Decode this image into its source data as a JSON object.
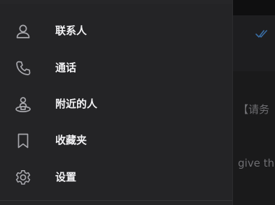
{
  "drawer": {
    "items": [
      {
        "label": "联系人",
        "icon": "person-icon"
      },
      {
        "label": "通话",
        "icon": "phone-icon"
      },
      {
        "label": "附近的人",
        "icon": "people-nearby-icon"
      },
      {
        "label": "收藏夹",
        "icon": "bookmark-icon"
      },
      {
        "label": "设置",
        "icon": "gear-icon"
      }
    ]
  },
  "background_chat": {
    "snippet_1": "【请务",
    "snippet_2": "give this",
    "read_receipt_icon": "double-check-icon"
  },
  "colors": {
    "drawer_bg": "#242426",
    "text": "#f2f2f4",
    "icon": "#a8a8ad",
    "accent": "#3a6ea5"
  }
}
